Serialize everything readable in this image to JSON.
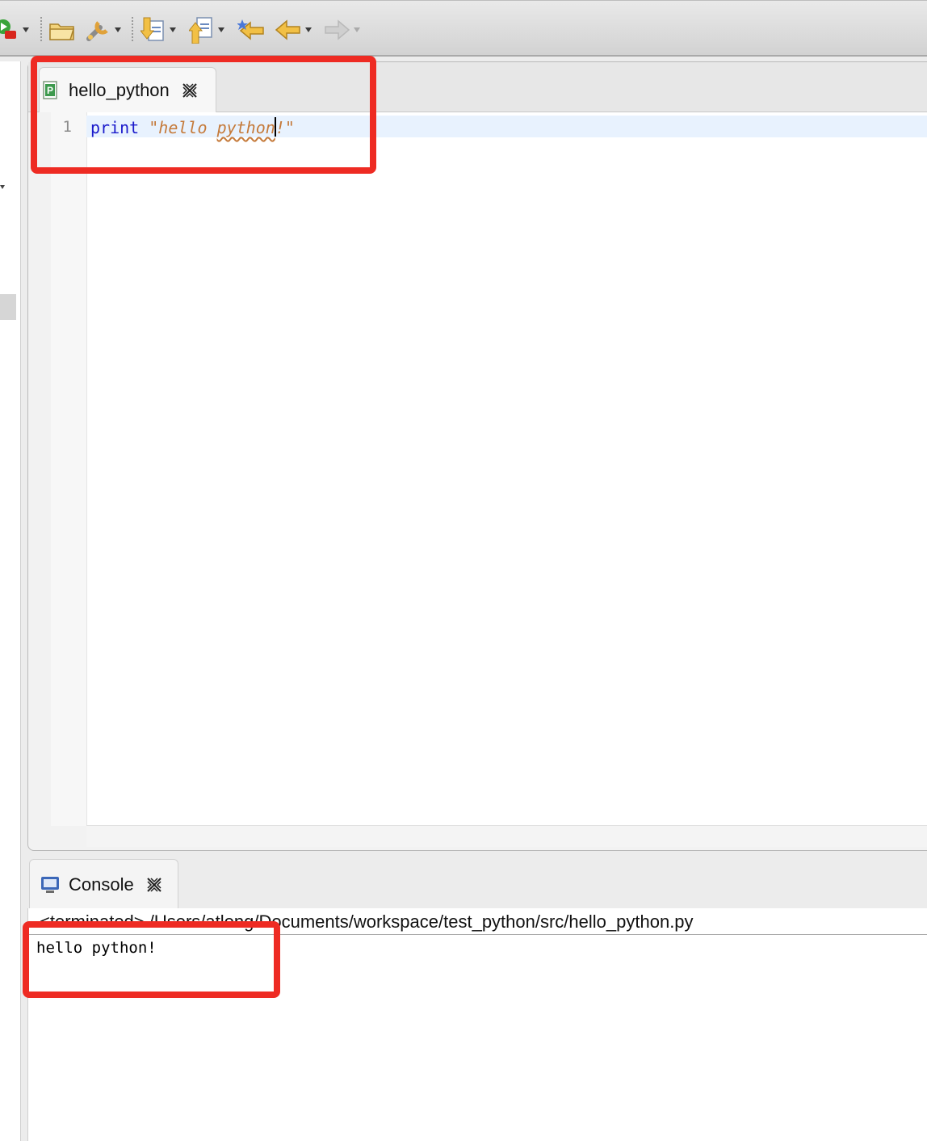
{
  "window": {
    "toolbar": {
      "items": [
        {
          "id": "run",
          "icon": "run-debug-icon"
        },
        {
          "id": "open",
          "icon": "open-folder-icon"
        },
        {
          "id": "tools",
          "icon": "wrench-icon"
        },
        {
          "id": "next-annotation",
          "icon": "next-annotation-icon"
        },
        {
          "id": "prev-annotation",
          "icon": "prev-annotation-icon"
        },
        {
          "id": "last-edit",
          "icon": "last-edit-location-icon"
        },
        {
          "id": "back",
          "icon": "back-arrow-icon"
        },
        {
          "id": "forward",
          "icon": "forward-arrow-icon"
        }
      ]
    },
    "editor": {
      "tab_label": "hello_python",
      "line_numbers": [
        "1"
      ],
      "code": {
        "keyword": "print",
        "string_open": "\"hello ",
        "string_misspelled": "python",
        "string_close": "!\""
      }
    },
    "console": {
      "tab_label": "Console",
      "path": "<terminated> /Users/atlong/Documents/workspace/test_python/src/hello_python.py",
      "output": "hello python!"
    },
    "colors": {
      "highlight": "#ee2b23",
      "keyword": "#1a1acb",
      "string": "#c57a3a",
      "current_line": "#e8f2fe"
    }
  }
}
